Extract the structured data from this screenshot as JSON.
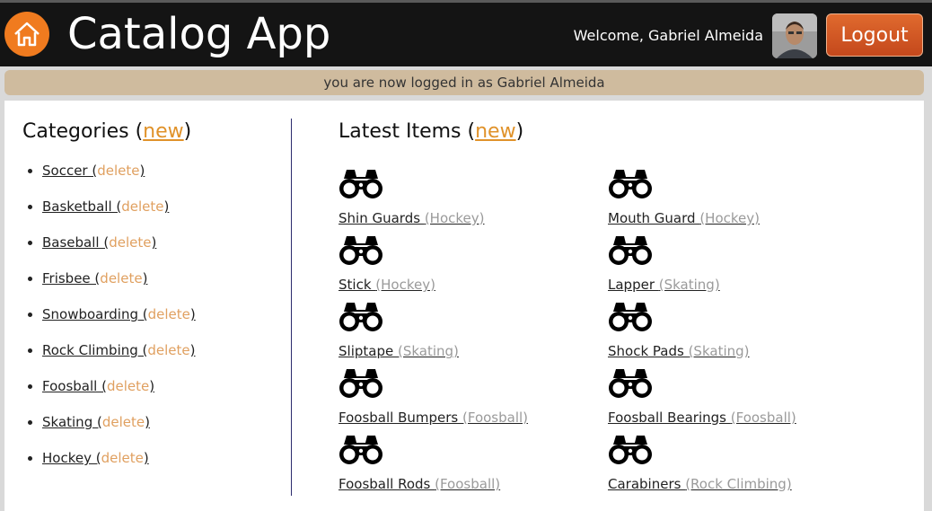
{
  "header": {
    "title": "Catalog App",
    "welcome": "Welcome, Gabriel Almeida",
    "logout_label": "Logout"
  },
  "flash": "you are now logged in as Gabriel Almeida",
  "categories": {
    "title": "Categories (",
    "new_label": "new",
    "close": ")",
    "delete_label": "delete",
    "items": [
      "Soccer",
      "Basketball",
      "Baseball",
      "Frisbee",
      "Snowboarding",
      "Rock Climbing",
      "Foosball",
      "Skating",
      "Hockey"
    ]
  },
  "latest": {
    "title": "Latest Items (",
    "new_label": "new",
    "close": ")",
    "items": [
      {
        "name": "Shin Guards",
        "category": "Hockey"
      },
      {
        "name": "Mouth Guard",
        "category": "Hockey"
      },
      {
        "name": "Stick",
        "category": "Hockey"
      },
      {
        "name": "Lapper",
        "category": "Skating"
      },
      {
        "name": "Sliptape",
        "category": "Skating"
      },
      {
        "name": "Shock Pads",
        "category": "Skating"
      },
      {
        "name": "Foosball Bumpers",
        "category": "Foosball"
      },
      {
        "name": "Foosball Bearings",
        "category": "Foosball"
      },
      {
        "name": "Foosball Rods",
        "category": "Foosball"
      },
      {
        "name": "Carabiners",
        "category": "Rock Climbing"
      }
    ]
  },
  "colors": {
    "accent": "#f07b1f",
    "logout": "#d0562a",
    "flash_bg": "#cfbb9e",
    "link_new": "#e0922a"
  }
}
